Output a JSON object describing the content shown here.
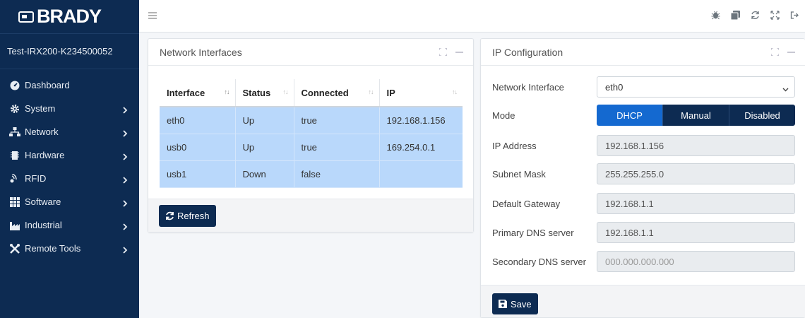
{
  "brand": {
    "name": "BRADY"
  },
  "sidebar": {
    "device_name": "Test-IRX200-K234500052",
    "items": [
      {
        "label": "Dashboard",
        "icon": "dashboard-icon",
        "has_children": false
      },
      {
        "label": "System",
        "icon": "gear-icon",
        "has_children": true
      },
      {
        "label": "Network",
        "icon": "network-icon",
        "has_children": true
      },
      {
        "label": "Hardware",
        "icon": "hardware-icon",
        "has_children": true
      },
      {
        "label": "RFID",
        "icon": "rfid-icon",
        "has_children": true
      },
      {
        "label": "Software",
        "icon": "grid-icon",
        "has_children": true
      },
      {
        "label": "Industrial",
        "icon": "industry-icon",
        "has_children": true
      },
      {
        "label": "Remote Tools",
        "icon": "tools-icon",
        "has_children": true
      }
    ]
  },
  "topbar": {
    "icons": [
      "bug-icon",
      "copy-icon",
      "refresh-icon",
      "fullscreen-icon",
      "logout-icon"
    ]
  },
  "network_interfaces": {
    "title": "Network Interfaces",
    "columns": [
      "Interface",
      "Status",
      "Connected",
      "IP"
    ],
    "rows": [
      [
        "eth0",
        "Up",
        "true",
        "192.168.1.156"
      ],
      [
        "usb0",
        "Up",
        "true",
        "169.254.0.1"
      ],
      [
        "usb1",
        "Down",
        "false",
        ""
      ]
    ],
    "refresh_label": "Refresh"
  },
  "ip_configuration": {
    "title": "IP Configuration",
    "network_interface_label": "Network Interface",
    "network_interface_value": "eth0",
    "mode_label": "Mode",
    "mode_options": [
      "DHCP",
      "Manual",
      "Disabled"
    ],
    "mode_selected": "DHCP",
    "ip_address_label": "IP Address",
    "ip_address_value": "192.168.1.156",
    "subnet_mask_label": "Subnet Mask",
    "subnet_mask_value": "255.255.255.0",
    "default_gateway_label": "Default Gateway",
    "default_gateway_value": "192.168.1.1",
    "primary_dns_label": "Primary DNS server",
    "primary_dns_value": "192.168.1.1",
    "secondary_dns_label": "Secondary DNS server",
    "secondary_dns_placeholder": "000.000.000.000",
    "save_label": "Save"
  },
  "colors": {
    "sidebar_bg": "#0d2b52",
    "accent": "#1469d0",
    "row_highlight": "#b9d8fb"
  }
}
